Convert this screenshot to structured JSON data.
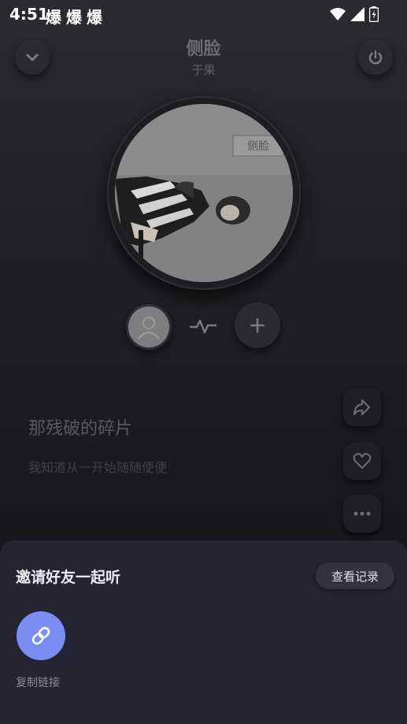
{
  "status_bar": {
    "time": "4:51",
    "glyphs": "爆爆爆",
    "icons": [
      "wifi-icon",
      "signal-icon",
      "battery-charging-icon"
    ]
  },
  "header": {
    "title": "侧脸",
    "artist": "于果",
    "collapse_icon": "chevron-down-icon",
    "power_icon": "power-icon"
  },
  "album_art": {
    "cover_text": "侧脸"
  },
  "controls": {
    "avatar_icon": "user-avatar-icon",
    "waveform_icon": "pulse-icon",
    "add_icon": "plus-icon"
  },
  "lyrics": {
    "current": "那残破的碎片",
    "next": "我知道从一开始随随便便"
  },
  "side_actions": [
    "share-icon",
    "heart-icon",
    "more-icon"
  ],
  "invite_sheet": {
    "title": "邀请好友一起听",
    "history_button": "查看记录",
    "copy_link_label": "复制链接",
    "accent": "#7b8cf2"
  }
}
